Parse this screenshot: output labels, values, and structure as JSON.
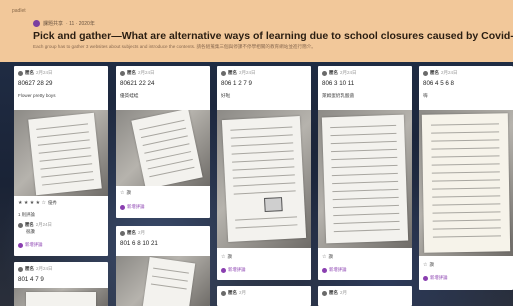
{
  "header": {
    "crumb": "padlet",
    "author_name": "課題共享",
    "author_meta": "· 11 · 2020年",
    "title": "Pick and gather—What are alternative ways of learning due to school closures caused by Covid-19?",
    "subtitle": "Each group has to gather 3 websites about subjects and introduce the contents. 請各組蒐集三個與停課不停學相關的教育網站並進行簡介。"
  },
  "columns": [
    {
      "cards": [
        {
          "author": "匿名",
          "meta": "2月24日",
          "title": "80627 28 29",
          "body": "Flower pretty boys",
          "rating_label": "★ ★ ★ ★ ☆",
          "rating_text": "優秀",
          "likes_label": "1 則評論",
          "reply_author": "匿名",
          "reply_meta": "2月24日",
          "reply_text": "很讚",
          "comment_label": "新增評論"
        },
        {
          "author": "匿名",
          "meta": "2月24日",
          "title": "801 4 7 9"
        }
      ]
    },
    {
      "cards": [
        {
          "author": "匿名",
          "meta": "2月24日",
          "title": "80621 22 24",
          "body": "優質蛙蛙",
          "like_label": "讚",
          "comment_label": "新增評論"
        },
        {
          "author": "匿名",
          "meta": "2月",
          "title": "801 6 8 10 21"
        }
      ]
    },
    {
      "cards": [
        {
          "author": "匿名",
          "meta": "2月24日",
          "title": "806 1 2 7 9",
          "body": "好啦",
          "like_label": "讚",
          "comment_label": "新增評論"
        },
        {
          "author": "匿名",
          "meta": "2月"
        }
      ]
    },
    {
      "cards": [
        {
          "author": "匿名",
          "meta": "2月24日",
          "title": "806 3 10 11",
          "body": "萊姆蛋奶乳酸菌",
          "like_label": "讚",
          "comment_label": "新增評論"
        },
        {
          "author": "匿名",
          "meta": "2月"
        }
      ]
    },
    {
      "cards": [
        {
          "author": "匿名",
          "meta": "2月24日",
          "title": "806 4 5 6 8",
          "body": "嗨",
          "like_label": "讚",
          "comment_label": "新增評論"
        }
      ]
    }
  ],
  "colors": {
    "header_bg": "#f2c89a",
    "card_bg": "#ffffff",
    "accent_purple": "#8a3fb0"
  }
}
